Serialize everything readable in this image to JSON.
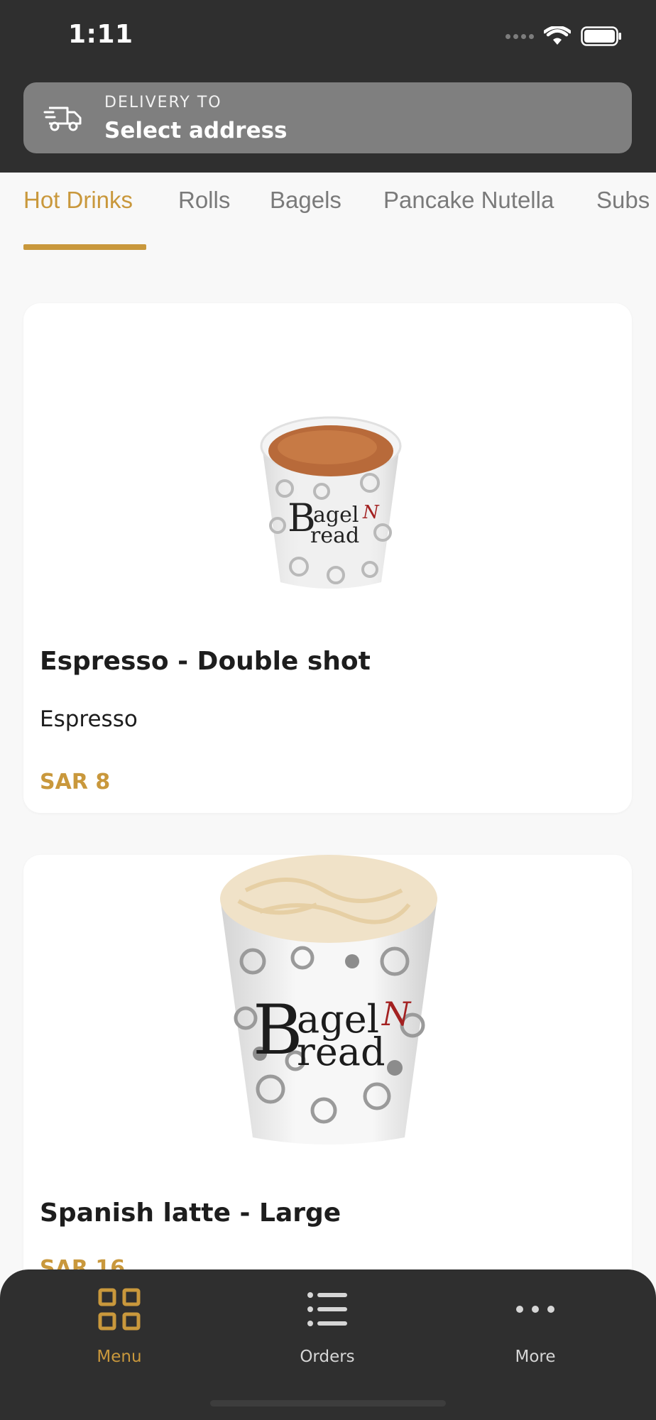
{
  "status_bar": {
    "time": "1:11"
  },
  "delivery": {
    "label": "DELIVERY TO",
    "value": "Select address",
    "icon": "truck-icon"
  },
  "tabs": [
    {
      "label": "Hot Drinks",
      "active": true
    },
    {
      "label": "Rolls",
      "active": false
    },
    {
      "label": "Bagels",
      "active": false
    },
    {
      "label": "Pancake Nutella",
      "active": false
    },
    {
      "label": "Subs",
      "active": false
    }
  ],
  "products": [
    {
      "title": "Espresso - Double shot",
      "description": "Espresso",
      "price": "SAR 8",
      "brand": "BagelN Bread"
    },
    {
      "title": "Spanish latte - Large",
      "price": "SAR 16",
      "brand": "BagelN Bread"
    }
  ],
  "bottom_nav": [
    {
      "label": "Menu",
      "icon": "grid-icon",
      "active": true
    },
    {
      "label": "Orders",
      "icon": "list-icon",
      "active": false
    },
    {
      "label": "More",
      "icon": "more-dots-icon",
      "active": false
    }
  ],
  "colors": {
    "accent": "#c9983c",
    "header_bg": "#2f2f2f",
    "delivery_bg": "#7f7f7f"
  }
}
